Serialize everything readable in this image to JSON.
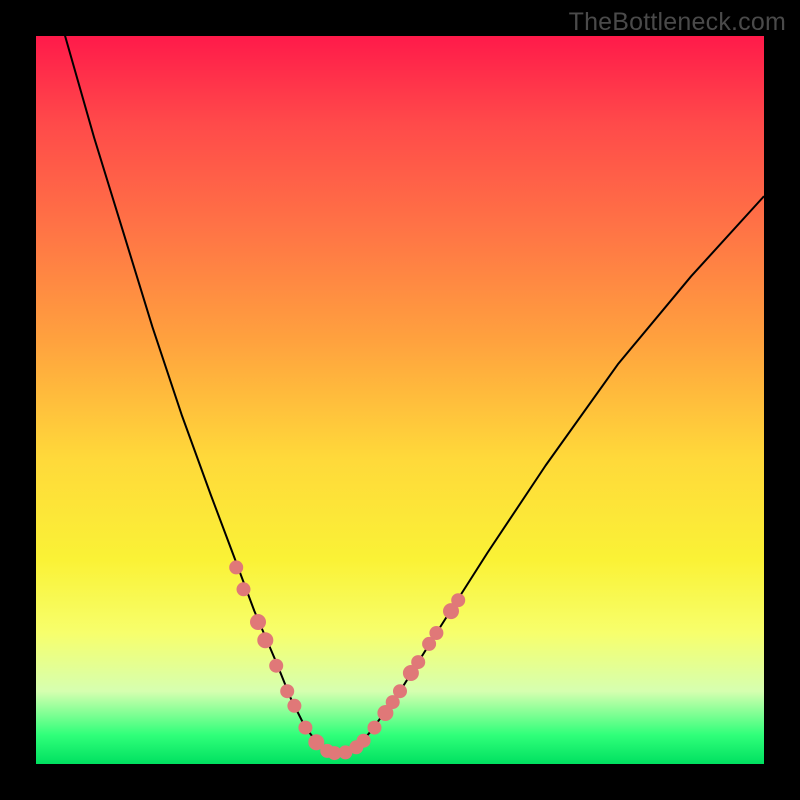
{
  "watermark": "TheBottleneck.com",
  "chart_data": {
    "type": "line",
    "title": "",
    "xlabel": "",
    "ylabel": "",
    "xlim": [
      0,
      100
    ],
    "ylim": [
      0,
      100
    ],
    "series": [
      {
        "name": "curve",
        "x": [
          0,
          4,
          8,
          12,
          16,
          20,
          24,
          27,
          30,
          33,
          35,
          37,
          39,
          40,
          42,
          44,
          46,
          50,
          55,
          62,
          70,
          80,
          90,
          100
        ],
        "y": [
          115,
          100,
          86,
          73,
          60,
          48,
          37,
          29,
          21,
          14,
          9,
          5,
          2.5,
          1.6,
          1.4,
          2.2,
          4.5,
          10,
          18,
          29,
          41,
          55,
          67,
          78
        ]
      }
    ],
    "markers": {
      "name": "highlight-points",
      "color": "#e07878",
      "points": [
        {
          "x": 27.5,
          "y": 27,
          "r": 7
        },
        {
          "x": 28.5,
          "y": 24,
          "r": 7
        },
        {
          "x": 30.5,
          "y": 19.5,
          "r": 8
        },
        {
          "x": 31.5,
          "y": 17,
          "r": 8
        },
        {
          "x": 33,
          "y": 13.5,
          "r": 7
        },
        {
          "x": 34.5,
          "y": 10,
          "r": 7
        },
        {
          "x": 35.5,
          "y": 8,
          "r": 7
        },
        {
          "x": 37,
          "y": 5,
          "r": 7
        },
        {
          "x": 38.5,
          "y": 3,
          "r": 8
        },
        {
          "x": 40,
          "y": 1.8,
          "r": 7
        },
        {
          "x": 41,
          "y": 1.5,
          "r": 7
        },
        {
          "x": 42.5,
          "y": 1.6,
          "r": 7
        },
        {
          "x": 44,
          "y": 2.3,
          "r": 7
        },
        {
          "x": 45,
          "y": 3.2,
          "r": 7
        },
        {
          "x": 46.5,
          "y": 5,
          "r": 7
        },
        {
          "x": 48,
          "y": 7,
          "r": 8
        },
        {
          "x": 49,
          "y": 8.5,
          "r": 7
        },
        {
          "x": 50,
          "y": 10,
          "r": 7
        },
        {
          "x": 51.5,
          "y": 12.5,
          "r": 8
        },
        {
          "x": 52.5,
          "y": 14,
          "r": 7
        },
        {
          "x": 54,
          "y": 16.5,
          "r": 7
        },
        {
          "x": 55,
          "y": 18,
          "r": 7
        },
        {
          "x": 57,
          "y": 21,
          "r": 8
        },
        {
          "x": 58,
          "y": 22.5,
          "r": 7
        }
      ]
    }
  }
}
